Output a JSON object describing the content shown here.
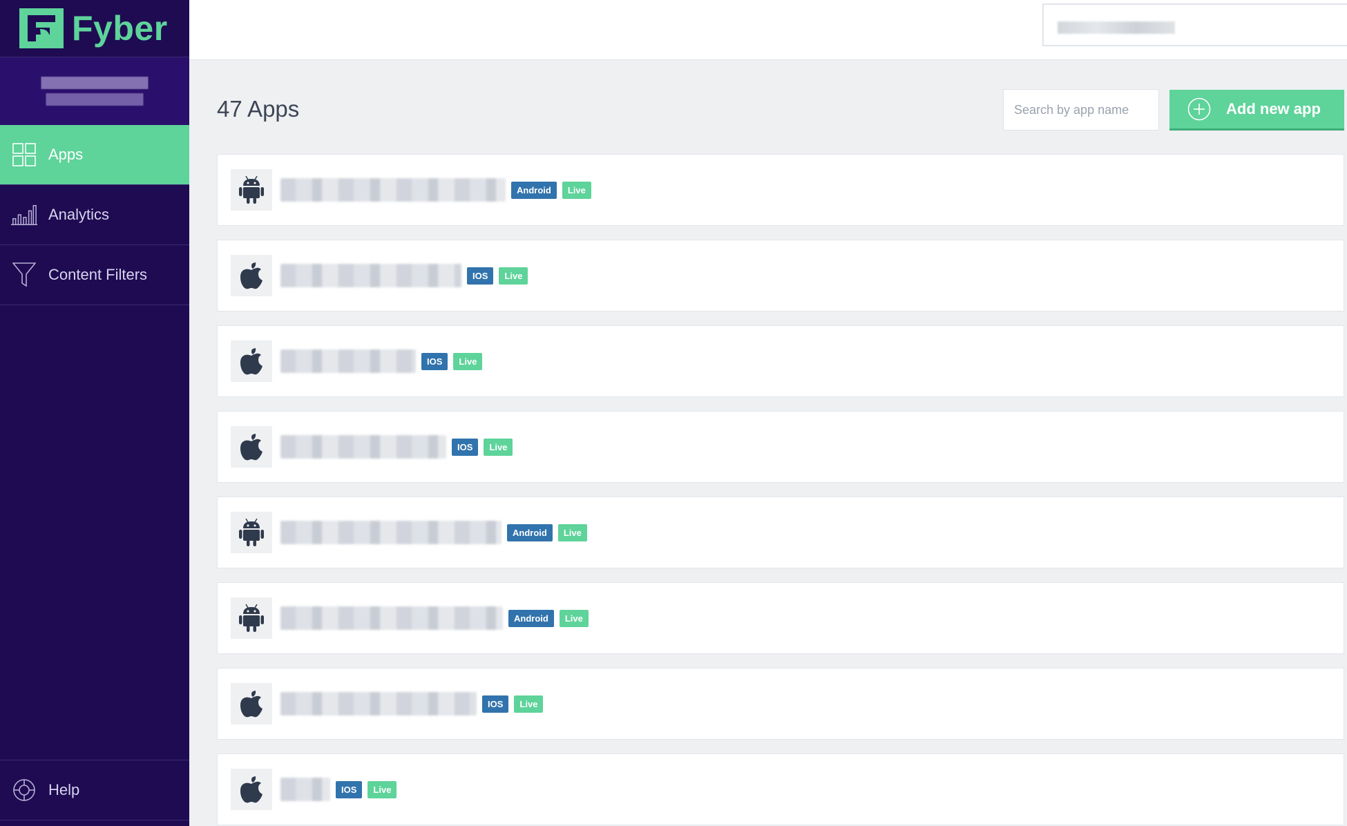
{
  "brand": {
    "name": "Fyber",
    "accent": "#5ed39a",
    "sidebar_bg": "#1e0b52"
  },
  "sidebar": {
    "items": [
      {
        "label": "Apps",
        "icon": "grid-icon",
        "active": true
      },
      {
        "label": "Analytics",
        "icon": "bar-chart-icon",
        "active": false
      },
      {
        "label": "Content Filters",
        "icon": "filter-icon",
        "active": false
      }
    ],
    "help": {
      "label": "Help",
      "icon": "lifebuoy-icon"
    }
  },
  "main": {
    "title": "47 Apps",
    "search": {
      "placeholder": "Search by app name",
      "value": ""
    },
    "add_button": {
      "label": "Add new app",
      "icon": "plus-circle-icon"
    },
    "apps": [
      {
        "platform": "Android",
        "status": "Live",
        "icon": "android-icon"
      },
      {
        "platform": "IOS",
        "status": "Live",
        "icon": "apple-icon"
      },
      {
        "platform": "IOS",
        "status": "Live",
        "icon": "apple-icon"
      },
      {
        "platform": "IOS",
        "status": "Live",
        "icon": "apple-icon"
      },
      {
        "platform": "Android",
        "status": "Live",
        "icon": "android-icon"
      },
      {
        "platform": "Android",
        "status": "Live",
        "icon": "android-icon"
      },
      {
        "platform": "IOS",
        "status": "Live",
        "icon": "apple-icon"
      },
      {
        "platform": "IOS",
        "status": "Live",
        "icon": "apple-icon"
      }
    ]
  },
  "colors": {
    "platform_badge": "#3173ad",
    "status_badge": "#5ed39a"
  }
}
